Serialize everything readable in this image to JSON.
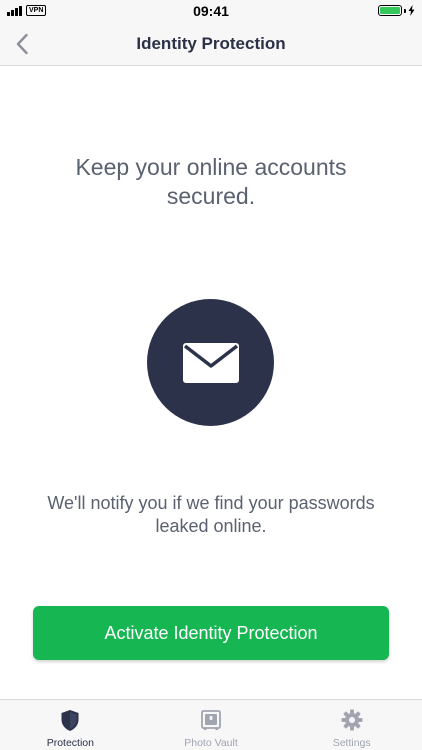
{
  "status_bar": {
    "time": "09:41",
    "vpn_label": "VPN",
    "battery_level": 1.0,
    "battery_color": "#34c759"
  },
  "header": {
    "title": "Identity Protection",
    "back_icon": "chevron-left-icon"
  },
  "main": {
    "headline": "Keep your online accounts secured.",
    "illustration_icon": "envelope-icon",
    "description": "We'll notify you if we find your passwords leaked online.",
    "cta_label": "Activate Identity Protection"
  },
  "tab_bar": {
    "items": [
      {
        "label": "Protection",
        "icon": "shield-icon",
        "active": true
      },
      {
        "label": "Photo Vault",
        "icon": "vault-icon",
        "active": false
      },
      {
        "label": "Settings",
        "icon": "gear-icon",
        "active": false
      }
    ]
  },
  "colors": {
    "accent_green": "#16b752",
    "navy": "#2b324a",
    "text_gray": "#5a6170",
    "inactive_gray": "#a1a5b0"
  }
}
